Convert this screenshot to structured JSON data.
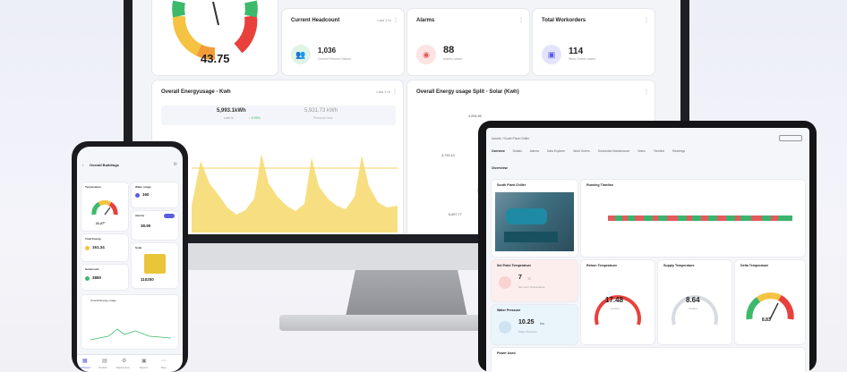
{
  "colors": {
    "accent": "#5a5ce6",
    "gauge_green": "#3db96b",
    "gauge_yellow": "#f5c342",
    "gauge_orange": "#f29d38",
    "gauge_red": "#e8413c",
    "energy_area": "#f6d96b",
    "status_green": "#3bb36e",
    "status_red": "#e35a5a"
  },
  "monitor": {
    "gauge_value": "43.75",
    "headcount": {
      "title": "Current Headcount",
      "range": "Last 1 hr",
      "value": "1,036",
      "sub": "Current Present Visitors"
    },
    "alarms": {
      "title": "Alarms",
      "value": "88",
      "sub": "Alarms raised"
    },
    "workorders": {
      "title": "Total Workorders",
      "value": "114",
      "sub": "Work Orders raised"
    },
    "energy": {
      "title": "Overall Energyusage - Kwh",
      "range": "Last 1 hr",
      "total": "5,993.1kWh",
      "total_label": "Last hr",
      "change": "↓ 6.95%",
      "prev": "5,931.73 kWh",
      "prev_label": "Previous hour"
    },
    "energy_split": {
      "title": "Overall Energy usage Split - Solar (Kwh)",
      "label_a": "3,793.10",
      "label_b": "6,697.77",
      "label_c": "4,094.86"
    }
  },
  "phone": {
    "title": "Overall Buildings",
    "temp_label": "Temperature",
    "temp_value": "21.27°",
    "water_label": "Water usage",
    "water_value": "160",
    "alarm_label": "Alarms",
    "alarm_value": "38.90",
    "energy_label": "Total Energy",
    "energy_value": "161.34",
    "headcount_label": "Headcount",
    "headcount_value": "3880",
    "solar_label": "Solar",
    "solar_value": "110200",
    "chart_title": "Overall Energy usage",
    "nav": [
      "Dashboard",
      "Portfolio",
      "Maintenance",
      "Reports",
      "More"
    ]
  },
  "tablet": {
    "breadcrumb": "Assets / South Plant Chiller",
    "tabs": [
      "Overview",
      "Details",
      "Alarms",
      "Data Explorer",
      "Work Orders",
      "Scheduled Maintenance",
      "Notes",
      "Timeline",
      "Readings"
    ],
    "overview_label": "Overview",
    "asset_name": "South Plant Chiller",
    "running_title": "Running Timeline",
    "setpoint": {
      "title": "Set Point Temperature",
      "value": "7",
      "unit": "°C",
      "sub": "Set point Temperature"
    },
    "water_pressure": {
      "title": "Water Pressure",
      "value": "10.25",
      "unit": "bar",
      "sub": "Water Pressure"
    },
    "return_temp": {
      "title": "Return Temperature",
      "value": "17.48",
      "unit": "Celsius"
    },
    "supply_temp": {
      "title": "Supply Temperature",
      "value": "8.64",
      "unit": "Celsius"
    },
    "delta_temp": {
      "title": "Delta Temperature",
      "value": "8.83"
    },
    "power_title": "Power Used"
  }
}
